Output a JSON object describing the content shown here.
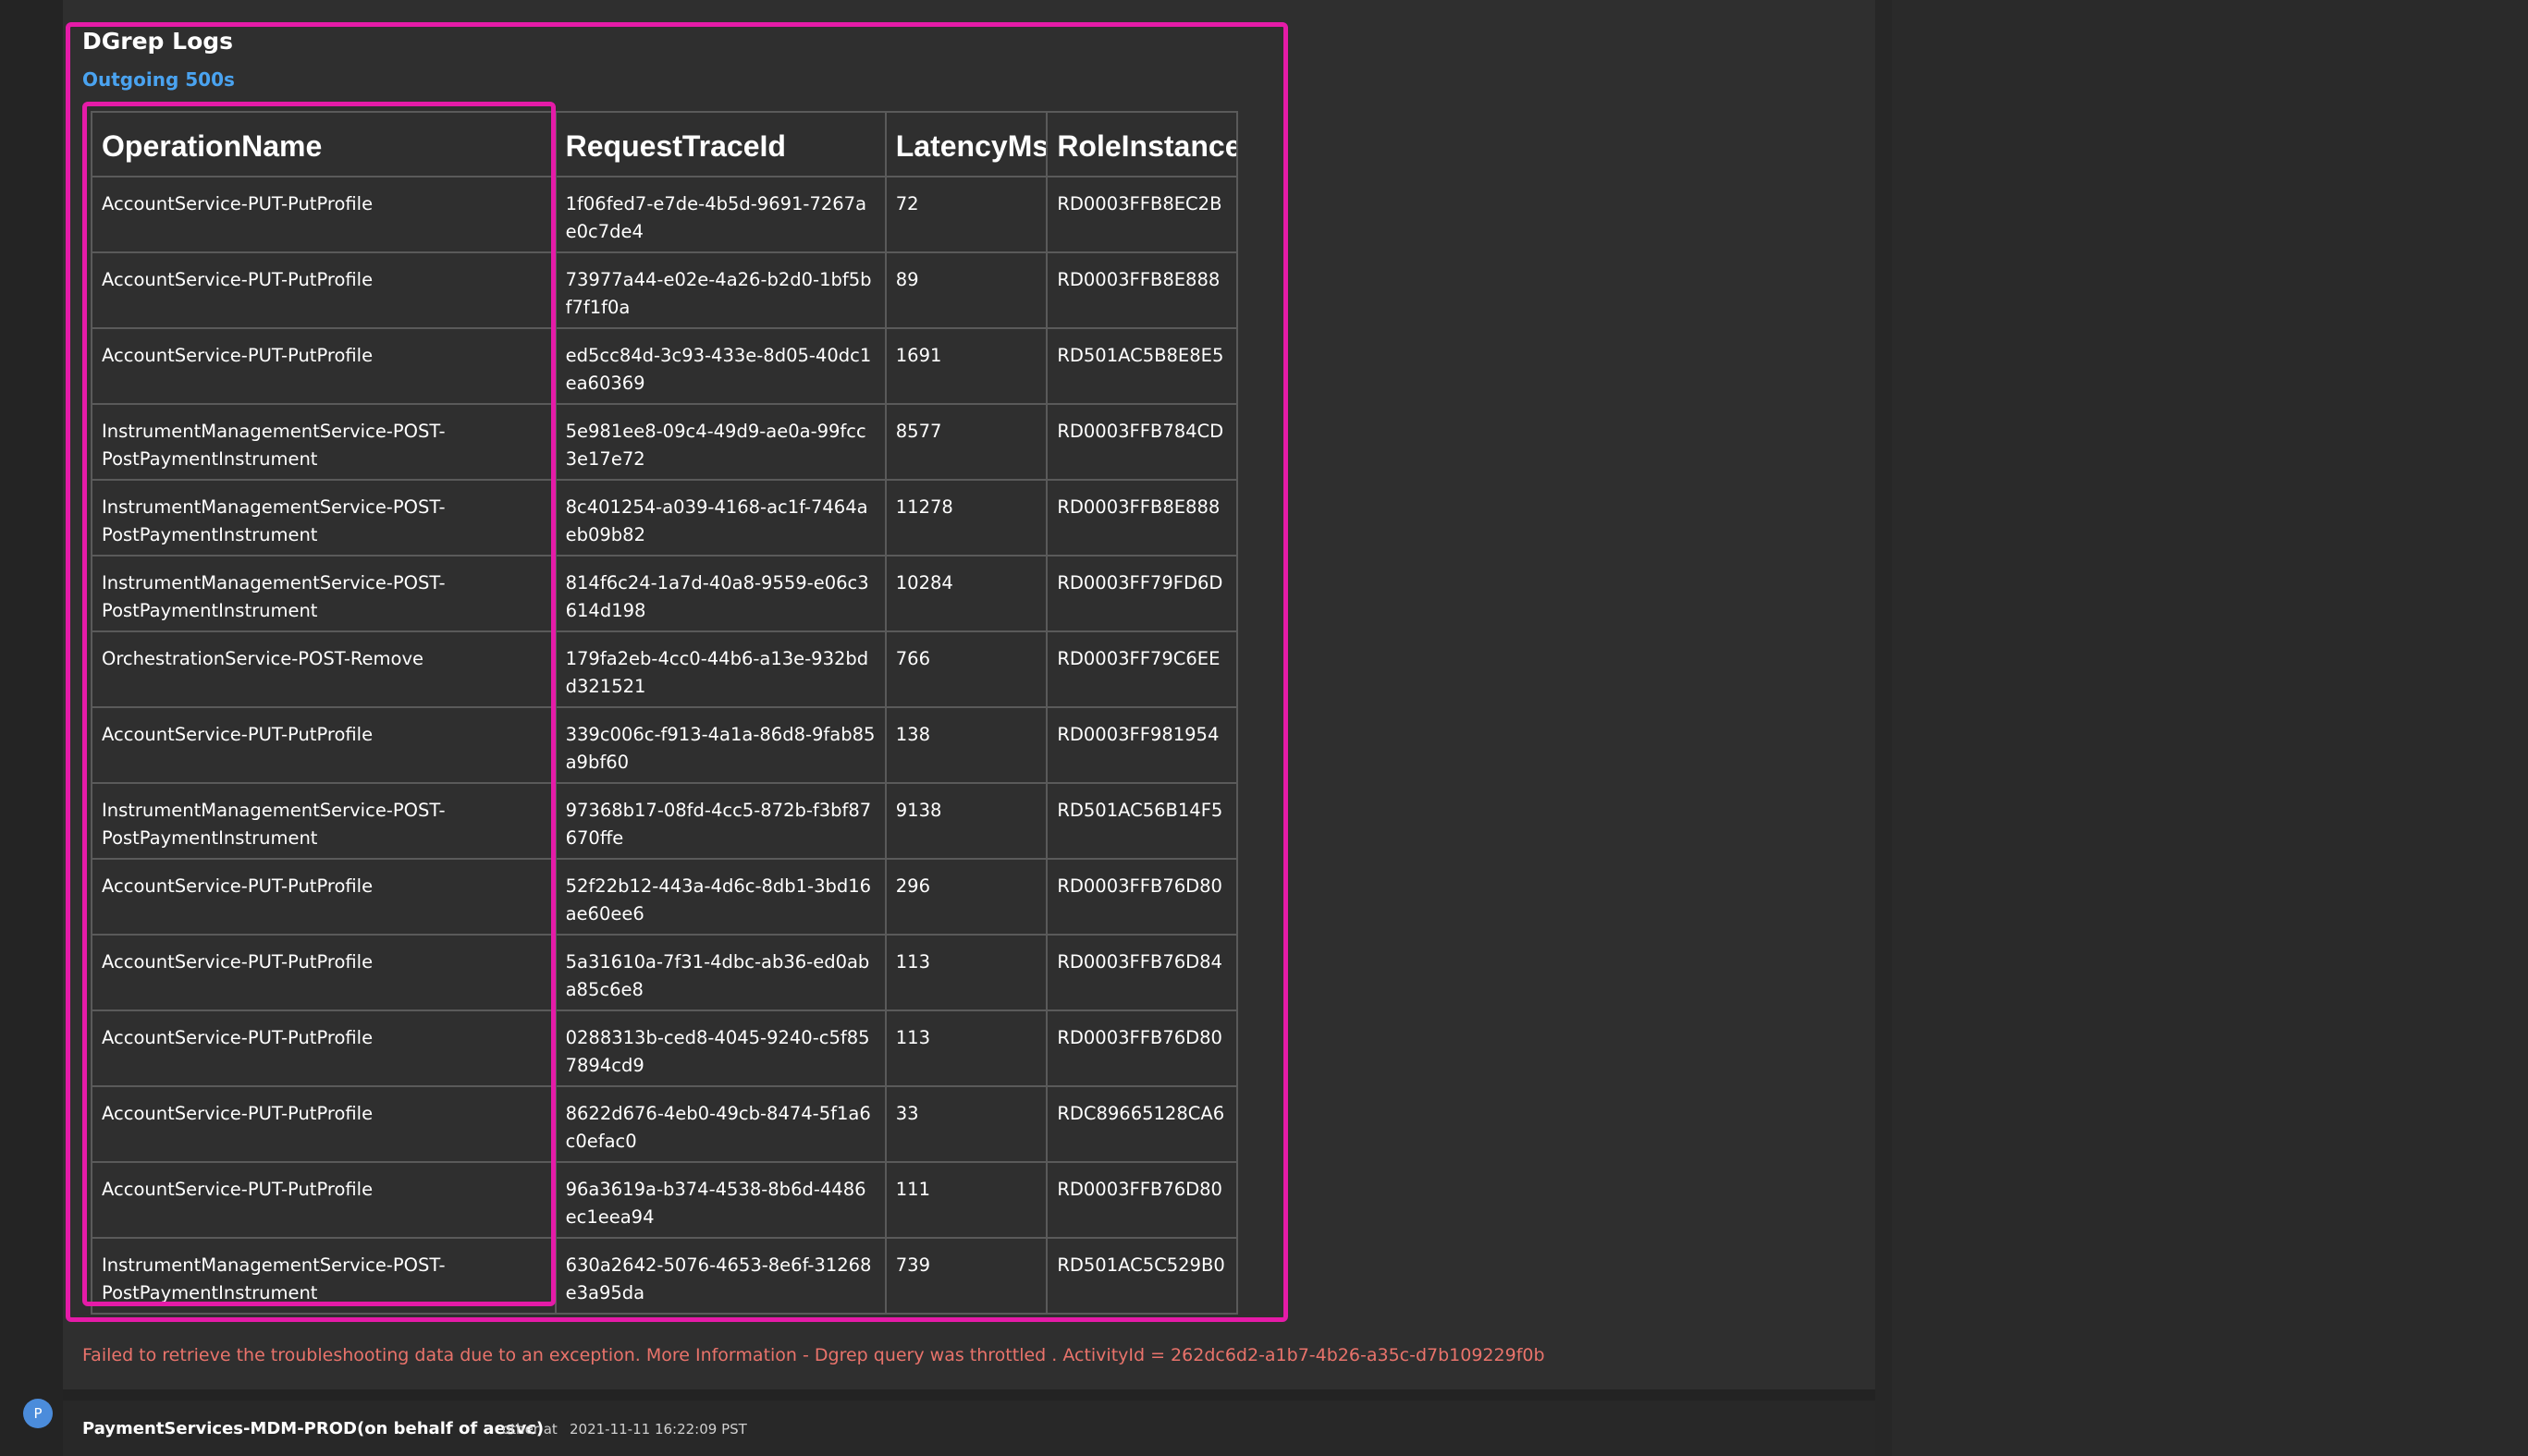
{
  "card": {
    "title": "DGrep Logs",
    "subtitle": "Outgoing 500s"
  },
  "table": {
    "columns": [
      "OperationName",
      "RequestTraceId",
      "LatencyMs",
      "RoleInstance"
    ],
    "rows": [
      [
        "AccountService-PUT-PutProfile",
        "1f06fed7-e7de-4b5d-9691-7267ae0c7de4",
        "72",
        "RD0003FFB8EC2B"
      ],
      [
        "AccountService-PUT-PutProfile",
        "73977a44-e02e-4a26-b2d0-1bf5bf7f1f0a",
        "89",
        "RD0003FFB8E888"
      ],
      [
        "AccountService-PUT-PutProfile",
        "ed5cc84d-3c93-433e-8d05-40dc1ea60369",
        "1691",
        "RD501AC5B8E8E5"
      ],
      [
        "InstrumentManagementService-POST-PostPaymentInstrument",
        "5e981ee8-09c4-49d9-ae0a-99fcc3e17e72",
        "8577",
        "RD0003FFB784CD"
      ],
      [
        "InstrumentManagementService-POST-PostPaymentInstrument",
        "8c401254-a039-4168-ac1f-7464aeb09b82",
        "11278",
        "RD0003FFB8E888"
      ],
      [
        "InstrumentManagementService-POST-PostPaymentInstrument",
        "814f6c24-1a7d-40a8-9559-e06c3614d198",
        "10284",
        "RD0003FF79FD6D"
      ],
      [
        "OrchestrationService-POST-Remove",
        "179fa2eb-4cc0-44b6-a13e-932bdd321521",
        "766",
        "RD0003FF79C6EE"
      ],
      [
        "AccountService-PUT-PutProfile",
        "339c006c-f913-4a1a-86d8-9fab85a9bf60",
        "138",
        "RD0003FF981954"
      ],
      [
        "InstrumentManagementService-POST-PostPaymentInstrument",
        "97368b17-08fd-4cc5-872b-f3bf87670ffe",
        "9138",
        "RD501AC56B14F5"
      ],
      [
        "AccountService-PUT-PutProfile",
        "52f22b12-443a-4d6c-8db1-3bd16ae60ee6",
        "296",
        "RD0003FFB76D80"
      ],
      [
        "AccountService-PUT-PutProfile",
        "5a31610a-7f31-4dbc-ab36-ed0aba85c6e8",
        "113",
        "RD0003FFB76D84"
      ],
      [
        "AccountService-PUT-PutProfile",
        "0288313b-ced8-4045-9240-c5f857894cd9",
        "113",
        "RD0003FFB76D80"
      ],
      [
        "AccountService-PUT-PutProfile",
        "8622d676-4eb0-49cb-8474-5f1a6c0efac0",
        "33",
        "RDC89665128CA6"
      ],
      [
        "AccountService-PUT-PutProfile",
        "96a3619a-b374-4538-8b6d-4486ec1eea94",
        "111",
        "RD0003FFB76D80"
      ],
      [
        "InstrumentManagementService-POST-PostPaymentInstrument",
        "630a2642-5076-4653-8e6f-31268e3a95da",
        "739",
        "RD501AC5C529B0"
      ]
    ]
  },
  "error": {
    "message": "Failed to retrieve the troubleshooting data due to an exception. More Information - Dgrep query was throttled . ActivityId = 262dc6d2-a1b7-4b26-a35c-d7b109229f0b"
  },
  "message_footer": {
    "avatar_initial": "P",
    "author": "PaymentServices-MDM-PROD(on behalf of aesvc)",
    "role": "other at",
    "timestamp": "2021-11-11 16:22:09 PST"
  },
  "colors": {
    "highlight": "#e51ba8",
    "link_blue": "#4aa3f0",
    "error_red": "#e9736b",
    "avatar_blue": "#4b8cdb"
  }
}
